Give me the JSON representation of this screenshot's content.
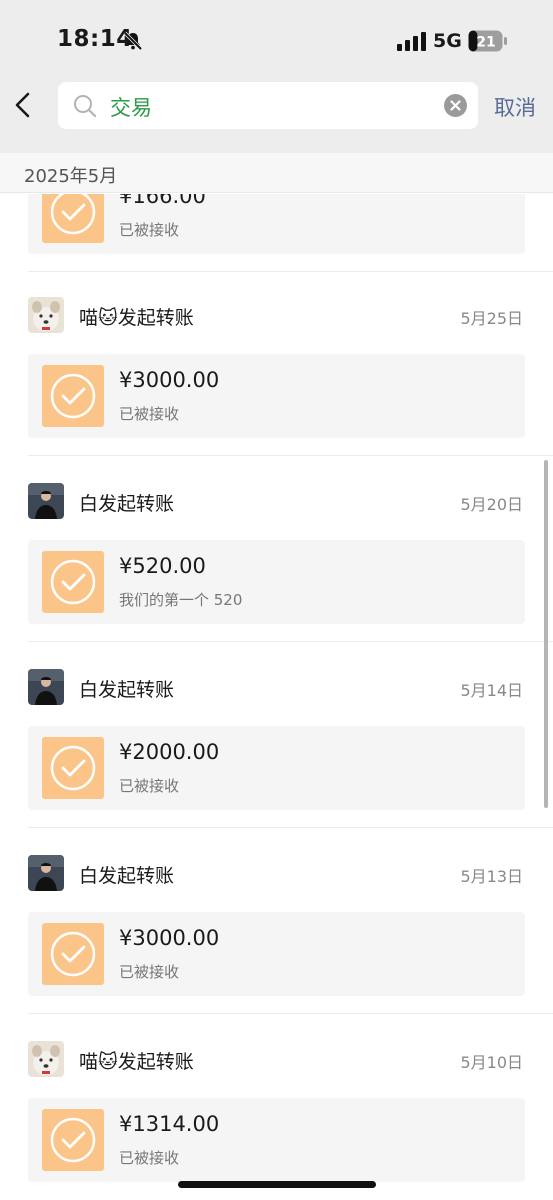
{
  "status_bar": {
    "time": "18:14",
    "network": "5G",
    "battery": "21"
  },
  "header": {
    "search_value": "交易",
    "cancel_label": "取消"
  },
  "month_label": "2025年5月",
  "partial": {
    "amount": "¥166.00",
    "note": "已被接收"
  },
  "transfers": [
    {
      "title": "喵🐱发起转账",
      "date": "5月25日",
      "amount": "¥3000.00",
      "note": "已被接收",
      "avatar": "dog"
    },
    {
      "title": "白发起转账",
      "date": "5月20日",
      "amount": "¥520.00",
      "note": "我们的第一个 520",
      "avatar": "man"
    },
    {
      "title": "白发起转账",
      "date": "5月14日",
      "amount": "¥2000.00",
      "note": "已被接收",
      "avatar": "man"
    },
    {
      "title": "白发起转账",
      "date": "5月13日",
      "amount": "¥3000.00",
      "note": "已被接收",
      "avatar": "man"
    },
    {
      "title": "喵🐱发起转账",
      "date": "5月10日",
      "amount": "¥1314.00",
      "note": "已被接收",
      "avatar": "dog"
    }
  ],
  "colors": {
    "accent_link": "#576b95",
    "search_text": "#2b9a4a",
    "transfer_icon_bg": "#fbc58a"
  }
}
